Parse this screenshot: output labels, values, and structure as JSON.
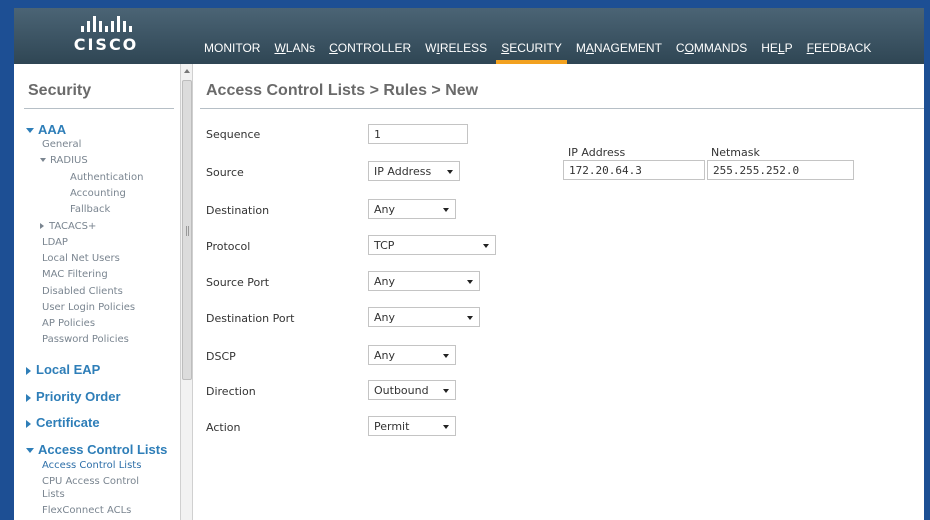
{
  "brand": {
    "logo_text": "CISCO"
  },
  "nav": {
    "items": [
      {
        "label": "MONITOR",
        "u": ""
      },
      {
        "label": "WLANs",
        "u": "W"
      },
      {
        "label": "CONTROLLER",
        "u": "C"
      },
      {
        "label": "WIRELESS",
        "u": "I"
      },
      {
        "label": "SECURITY",
        "u": "S"
      },
      {
        "label": "MANAGEMENT",
        "u": "A"
      },
      {
        "label": "COMMANDS",
        "u": "O"
      },
      {
        "label": "HELP",
        "u": "L"
      },
      {
        "label": "FEEDBACK",
        "u": "F"
      }
    ],
    "active": "SECURITY",
    "accent_color": "#f2a11f"
  },
  "sidebar": {
    "title": "Security",
    "aaa": "AAA",
    "general": "General",
    "radius": "RADIUS",
    "authentication": "Authentication",
    "accounting": "Accounting",
    "fallback": "Fallback",
    "tacacs": "TACACS+",
    "ldap": "LDAP",
    "local_net_users": "Local Net Users",
    "mac_filtering": "MAC Filtering",
    "disabled_clients": "Disabled Clients",
    "user_login_policies": "User Login Policies",
    "ap_policies": "AP Policies",
    "password_policies": "Password Policies",
    "local_eap": "Local EAP",
    "priority_order": "Priority Order",
    "certificate": "Certificate",
    "access_control_lists": "Access Control Lists",
    "acl_link": "Access Control Lists",
    "cpu_acl_line1": "CPU Access Control",
    "cpu_acl_line2": "Lists",
    "flexconnect_acls": "FlexConnect ACLs"
  },
  "main": {
    "title": "Access Control Lists > Rules > New",
    "labels": {
      "sequence": "Sequence",
      "source": "Source",
      "destination": "Destination",
      "protocol": "Protocol",
      "source_port": "Source Port",
      "destination_port": "Destination Port",
      "dscp": "DSCP",
      "direction": "Direction",
      "action": "Action"
    },
    "values": {
      "sequence": "1",
      "source": "IP Address",
      "destination": "Any",
      "protocol": "TCP",
      "source_port": "Any",
      "destination_port": "Any",
      "dscp": "Any",
      "direction": "Outbound",
      "action": "Permit"
    },
    "source_ip": {
      "ip_header": "IP Address",
      "netmask_header": "Netmask",
      "ip_value": "172.20.64.3",
      "netmask_value": "255.255.252.0"
    }
  }
}
